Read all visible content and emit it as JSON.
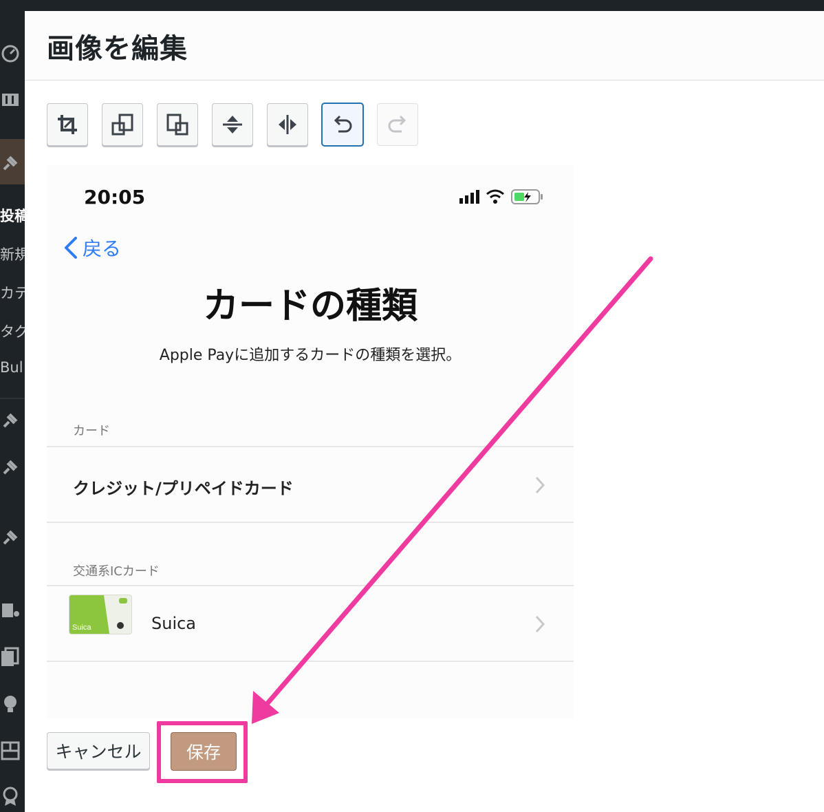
{
  "sidebar": {
    "items": [
      {
        "icon": "dashboard-icon"
      },
      {
        "icon": "settings-sliders-icon"
      },
      {
        "icon": "pin-icon"
      },
      {
        "label": "投稿"
      },
      {
        "label": "新規"
      },
      {
        "label": "カテ"
      },
      {
        "label": "タグ"
      },
      {
        "label": "Bul"
      },
      {
        "icon": "pin-icon"
      },
      {
        "icon": "pin-icon"
      },
      {
        "icon": "pin-icon"
      },
      {
        "icon": "media-icon"
      },
      {
        "icon": "pages-icon"
      },
      {
        "icon": "lightbulb-icon"
      },
      {
        "icon": "layout-icon"
      },
      {
        "icon": "badge-icon"
      }
    ]
  },
  "modal": {
    "title": "画像を編集",
    "toolbar": [
      {
        "icon": "crop-icon"
      },
      {
        "icon": "rotate-left-icon"
      },
      {
        "icon": "rotate-right-icon"
      },
      {
        "icon": "flip-vertical-icon"
      },
      {
        "icon": "flip-horizontal-icon"
      },
      {
        "icon": "undo-icon"
      },
      {
        "icon": "redo-icon"
      }
    ],
    "cancel_label": "キャンセル",
    "save_label": "保存"
  },
  "preview": {
    "status_time": "20:05",
    "back_label": "戻る",
    "title": "カードの種類",
    "subtitle": "Apple Payに追加するカードの種類を選択。",
    "sections": [
      {
        "label": "カード",
        "rows": [
          {
            "label": "クレジット/プリペイドカード"
          }
        ]
      },
      {
        "label": "交通系ICカード",
        "rows": [
          {
            "label": "Suica"
          }
        ]
      }
    ],
    "suica_card_text": "Suica"
  },
  "colors": {
    "accent": "#2271b1",
    "ios_blue": "#2f7df6",
    "highlight_pink": "#ef3aa0",
    "save_button": "#c19a80"
  }
}
